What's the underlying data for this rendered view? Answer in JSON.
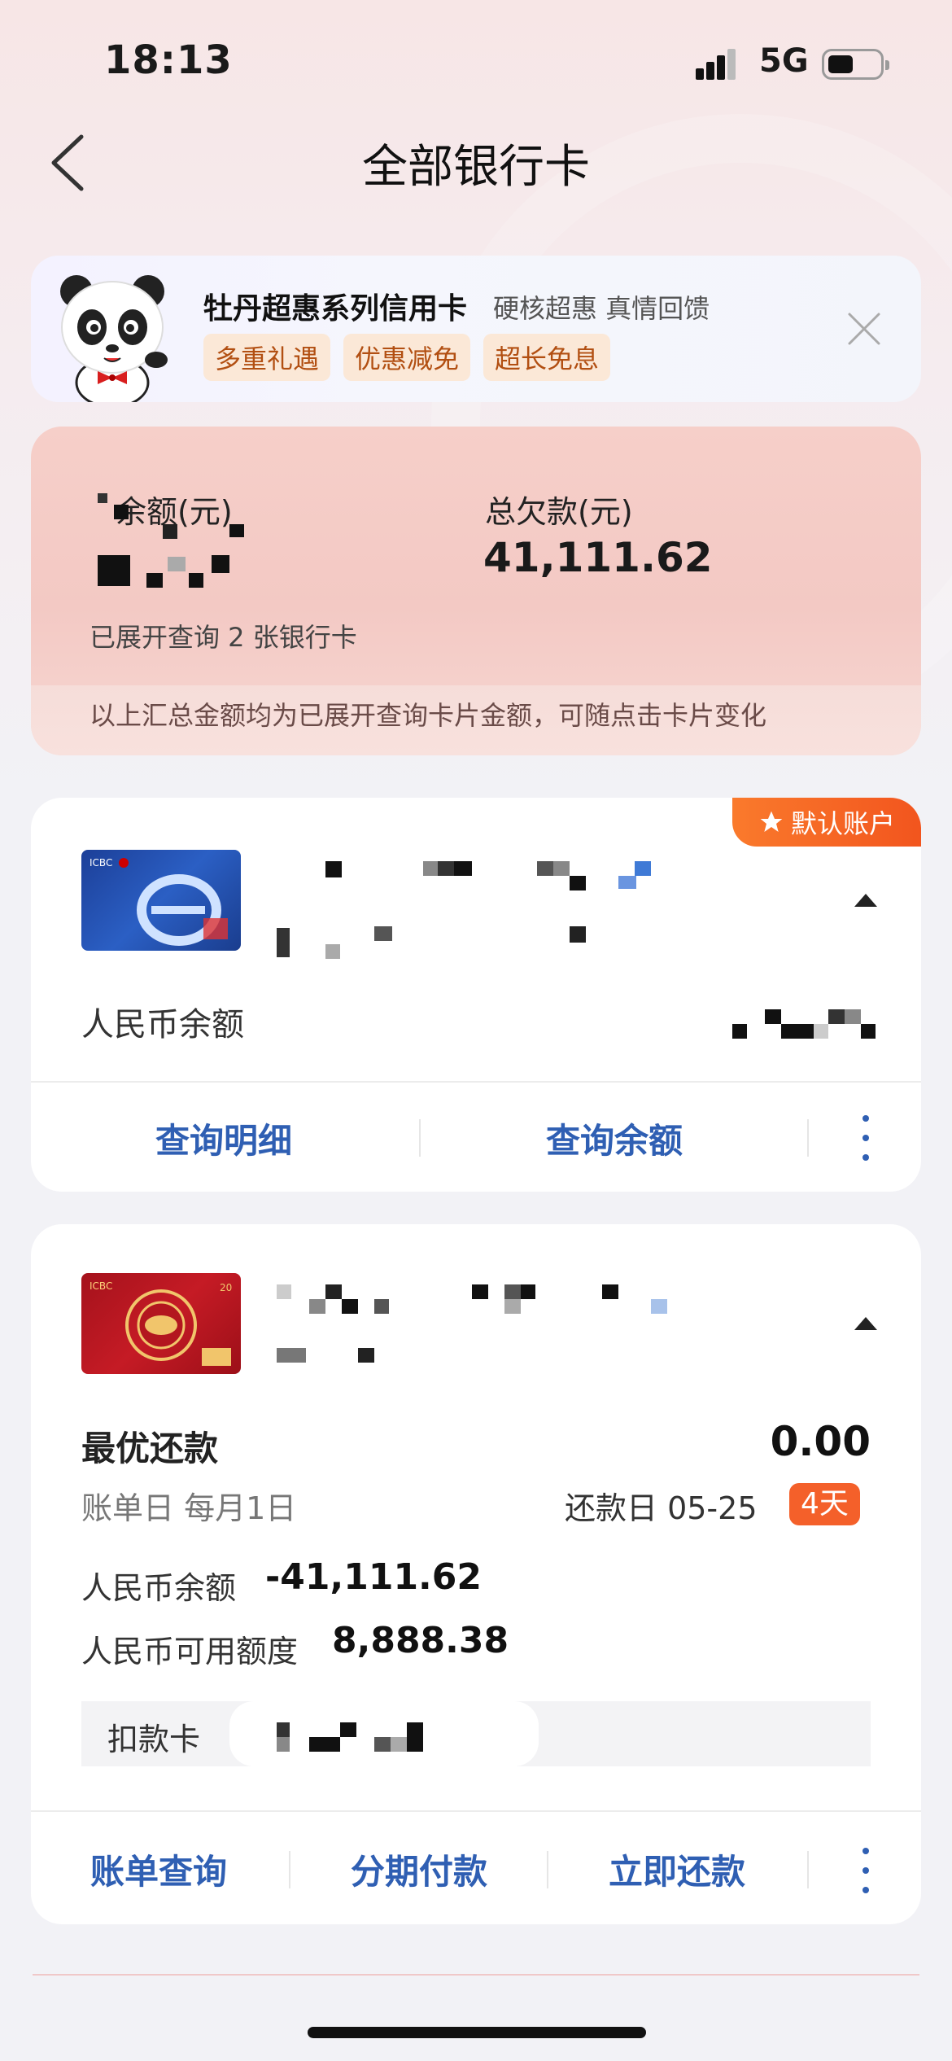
{
  "status_bar": {
    "time": "18:13",
    "network": "5G",
    "battery_percent": 40
  },
  "nav": {
    "title": "全部银行卡"
  },
  "promo": {
    "title": "牡丹超惠系列信用卡",
    "subtitle": "硬核超惠 真情回馈",
    "tags": [
      "多重礼遇",
      "优惠减免",
      "超长免息"
    ]
  },
  "summary": {
    "balance_label": "余额(元)",
    "debt_label": "总欠款(元)",
    "debt_value": "41,111.62",
    "expanded_count": "已展开查询 2 张银行卡",
    "note": "以上汇总金额均为已展开查询卡片金额，可随点击卡片变化"
  },
  "debit_card": {
    "default_badge": "默认账户",
    "rmb_balance_label": "人民币余额",
    "actions": [
      "查询明细",
      "查询余额"
    ]
  },
  "credit_card": {
    "best_repay_label": "最优还款",
    "best_repay_value": "0.00",
    "bill_day": "账单日 每月1日",
    "due_day": "还款日 05-25",
    "days_left": "4天",
    "rmb_balance_label": "人民币余额",
    "rmb_balance_value": "-41,111.62",
    "available_label": "人民币可用额度",
    "available_value": "8,888.38",
    "debit_label": "扣款卡",
    "actions": [
      "账单查询",
      "分期付款",
      "立即还款"
    ]
  },
  "icons": {
    "back": "chevron-left-icon",
    "close": "close-icon",
    "star": "star-icon",
    "collapse": "chevron-up-icon",
    "more": "more-vertical-icon"
  },
  "colors": {
    "accent_blue": "#2f5fb3",
    "badge_orange": "#f4602a",
    "summary_pink": "#f5cdc7"
  }
}
